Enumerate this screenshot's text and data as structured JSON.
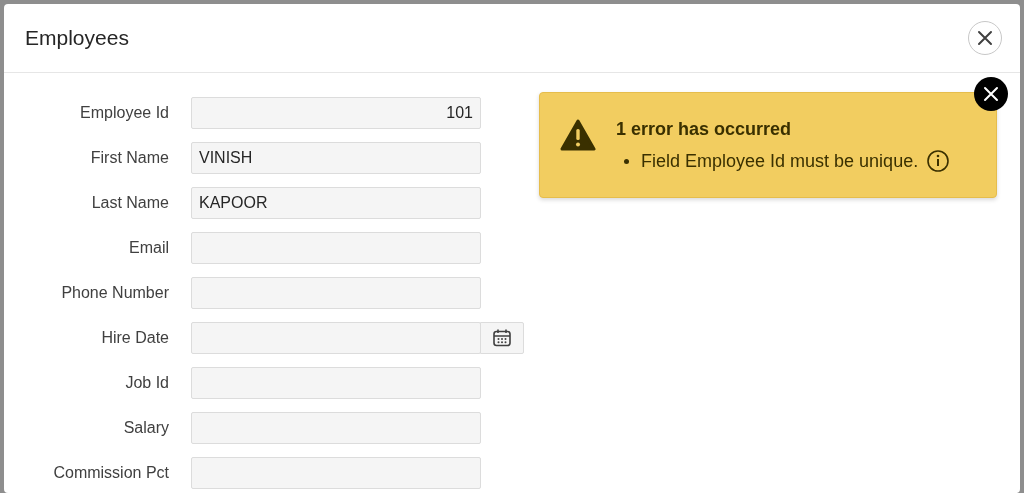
{
  "dialog": {
    "title": "Employees"
  },
  "form": {
    "fields": [
      {
        "label": "Employee Id",
        "kind": "number",
        "value": "101"
      },
      {
        "label": "First Name",
        "kind": "text",
        "value": "VINISH"
      },
      {
        "label": "Last Name",
        "kind": "text",
        "value": "KAPOOR"
      },
      {
        "label": "Email",
        "kind": "text"
      },
      {
        "label": "Phone Number",
        "kind": "text"
      },
      {
        "label": "Hire Date",
        "kind": "date"
      },
      {
        "label": "Job Id",
        "kind": "text"
      },
      {
        "label": "Salary",
        "kind": "number"
      },
      {
        "label": "Commission Pct",
        "kind": "number"
      }
    ]
  },
  "alert": {
    "title": "1 error has occurred",
    "messages": [
      "Field Employee Id must be unique."
    ]
  }
}
